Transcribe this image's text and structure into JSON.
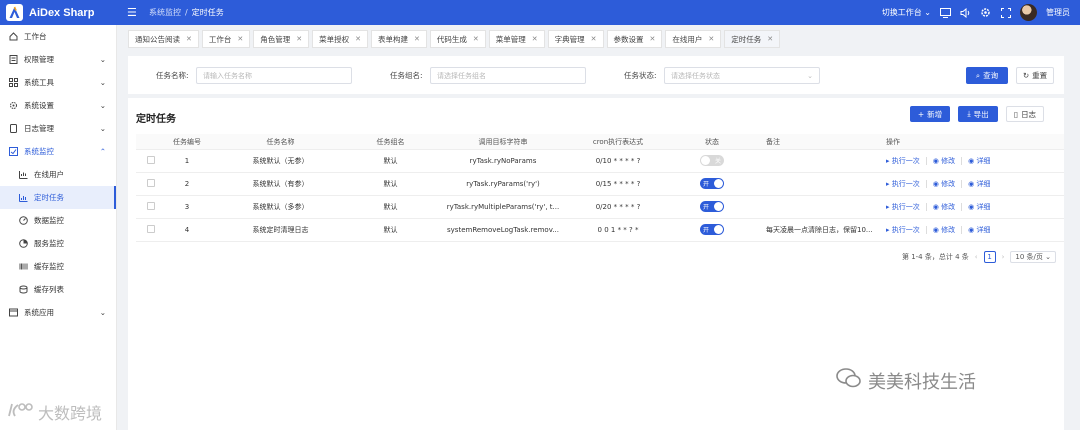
{
  "app": {
    "name": "AiDex Sharp",
    "accent": "#2d5cd9"
  },
  "breadcrumb": {
    "parent": "系统监控",
    "sep": "/",
    "current": "定时任务"
  },
  "topbar": {
    "switch_workbench": "切换工作台",
    "user_name": "管理员"
  },
  "sidebar": {
    "items": [
      {
        "label": "工作台",
        "icon": "home-icon"
      },
      {
        "label": "权限管理",
        "icon": "permission-icon"
      },
      {
        "label": "系统工具",
        "icon": "grid-icon"
      },
      {
        "label": "系统设置",
        "icon": "gear-icon"
      },
      {
        "label": "日志管理",
        "icon": "log-icon"
      },
      {
        "label": "系统监控",
        "icon": "monitor-icon"
      },
      {
        "label": "在线用户",
        "icon": "online-icon"
      },
      {
        "label": "定时任务",
        "icon": "chart-icon"
      },
      {
        "label": "数据监控",
        "icon": "dashboard-icon"
      },
      {
        "label": "服务监控",
        "icon": "pie-icon"
      },
      {
        "label": "缓存监控",
        "icon": "barcode-icon"
      },
      {
        "label": "缓存列表",
        "icon": "cache-icon"
      },
      {
        "label": "系统应用",
        "icon": "app-icon"
      }
    ]
  },
  "tabs": [
    "通知公告阅读",
    "工作台",
    "角色管理",
    "菜单授权",
    "表单构建",
    "代码生成",
    "菜单管理",
    "字典管理",
    "参数设置",
    "在线用户",
    "定时任务"
  ],
  "search": {
    "name_label": "任务名称:",
    "name_placeholder": "请输入任务名称",
    "group_label": "任务组名:",
    "group_placeholder": "请选择任务组名",
    "status_label": "任务状态:",
    "status_placeholder": "请选择任务状态",
    "query_btn": "查询",
    "reset_btn": "重置"
  },
  "card": {
    "title": "定时任务",
    "add_btn": "新增",
    "export_btn": "导出",
    "log_btn": "日志"
  },
  "table": {
    "headers": [
      "任务编号",
      "任务名称",
      "任务组名",
      "调用目标字符串",
      "cron执行表达式",
      "状态",
      "备注",
      "操作"
    ],
    "rows": [
      {
        "id": "1",
        "name": "系统默认（无参）",
        "group": "默认",
        "target": "ryTask.ryNoParams",
        "cron": "0/10 * * * * ?",
        "status_on": false,
        "status_text": "关",
        "remark": ""
      },
      {
        "id": "2",
        "name": "系统默认（有参）",
        "group": "默认",
        "target": "ryTask.ryParams('ry')",
        "cron": "0/15 * * * * ?",
        "status_on": true,
        "status_text": "开",
        "remark": ""
      },
      {
        "id": "3",
        "name": "系统默认（多参）",
        "group": "默认",
        "target": "ryTask.ryMultipleParams('ry', t...",
        "cron": "0/20 * * * * ?",
        "status_on": true,
        "status_text": "开",
        "remark": ""
      },
      {
        "id": "4",
        "name": "系统定时清理日志",
        "group": "默认",
        "target": "systemRemoveLogTask.remov...",
        "cron": "0 0 1 * * ? *",
        "status_on": true,
        "status_text": "开",
        "remark": "每天凌晨一点清除日志，保留10..."
      }
    ],
    "ops": {
      "run": "执行一次",
      "edit": "修改",
      "detail": "详细"
    }
  },
  "pager": {
    "summary": "第 1-4 条，总计 4 条",
    "page": "1",
    "size": "10 条/页"
  },
  "watermarks": {
    "wm1": "美美科技生活",
    "wm2": "大数跨境"
  }
}
